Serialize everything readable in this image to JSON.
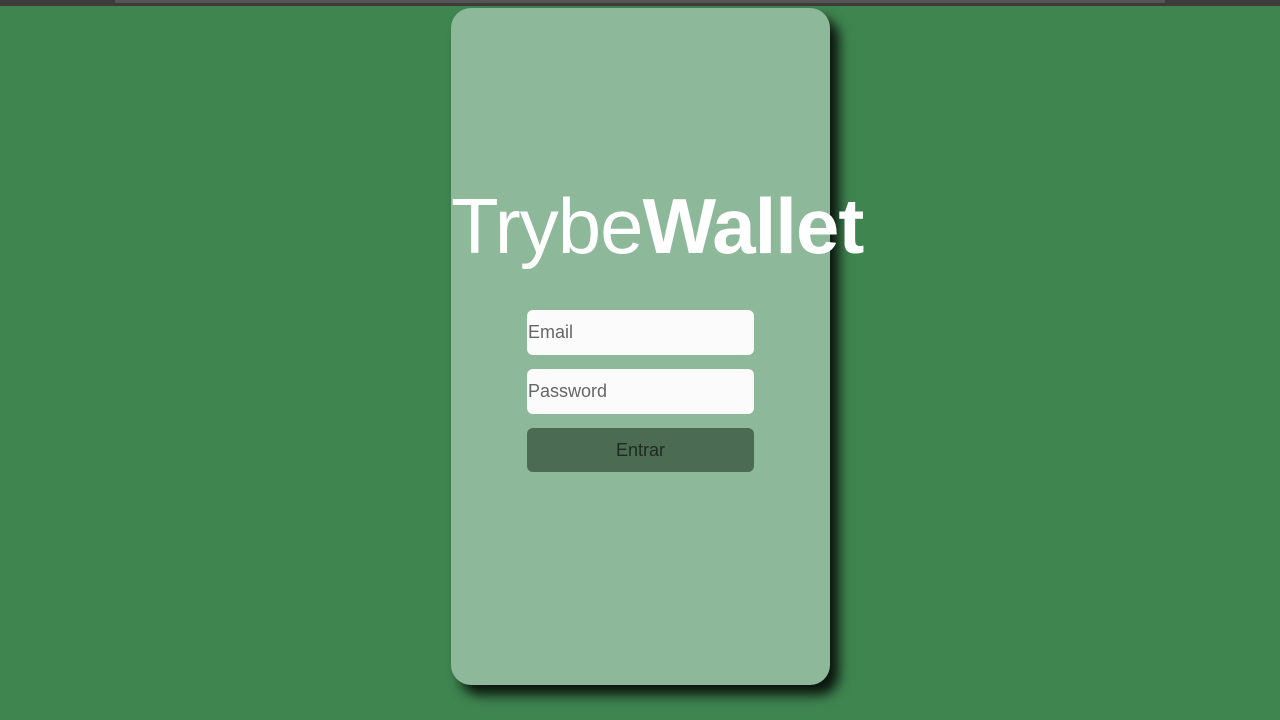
{
  "app": {
    "logo_light": "Trybe",
    "logo_bold": "Wallet"
  },
  "login": {
    "email_placeholder": "Email",
    "email_value": "",
    "password_placeholder": "Password",
    "password_value": "",
    "submit_label": "Entrar"
  },
  "colors": {
    "background": "#3f8550",
    "card": "#8db89a",
    "button": "#4b6b52",
    "logo_text": "#ffffff"
  }
}
